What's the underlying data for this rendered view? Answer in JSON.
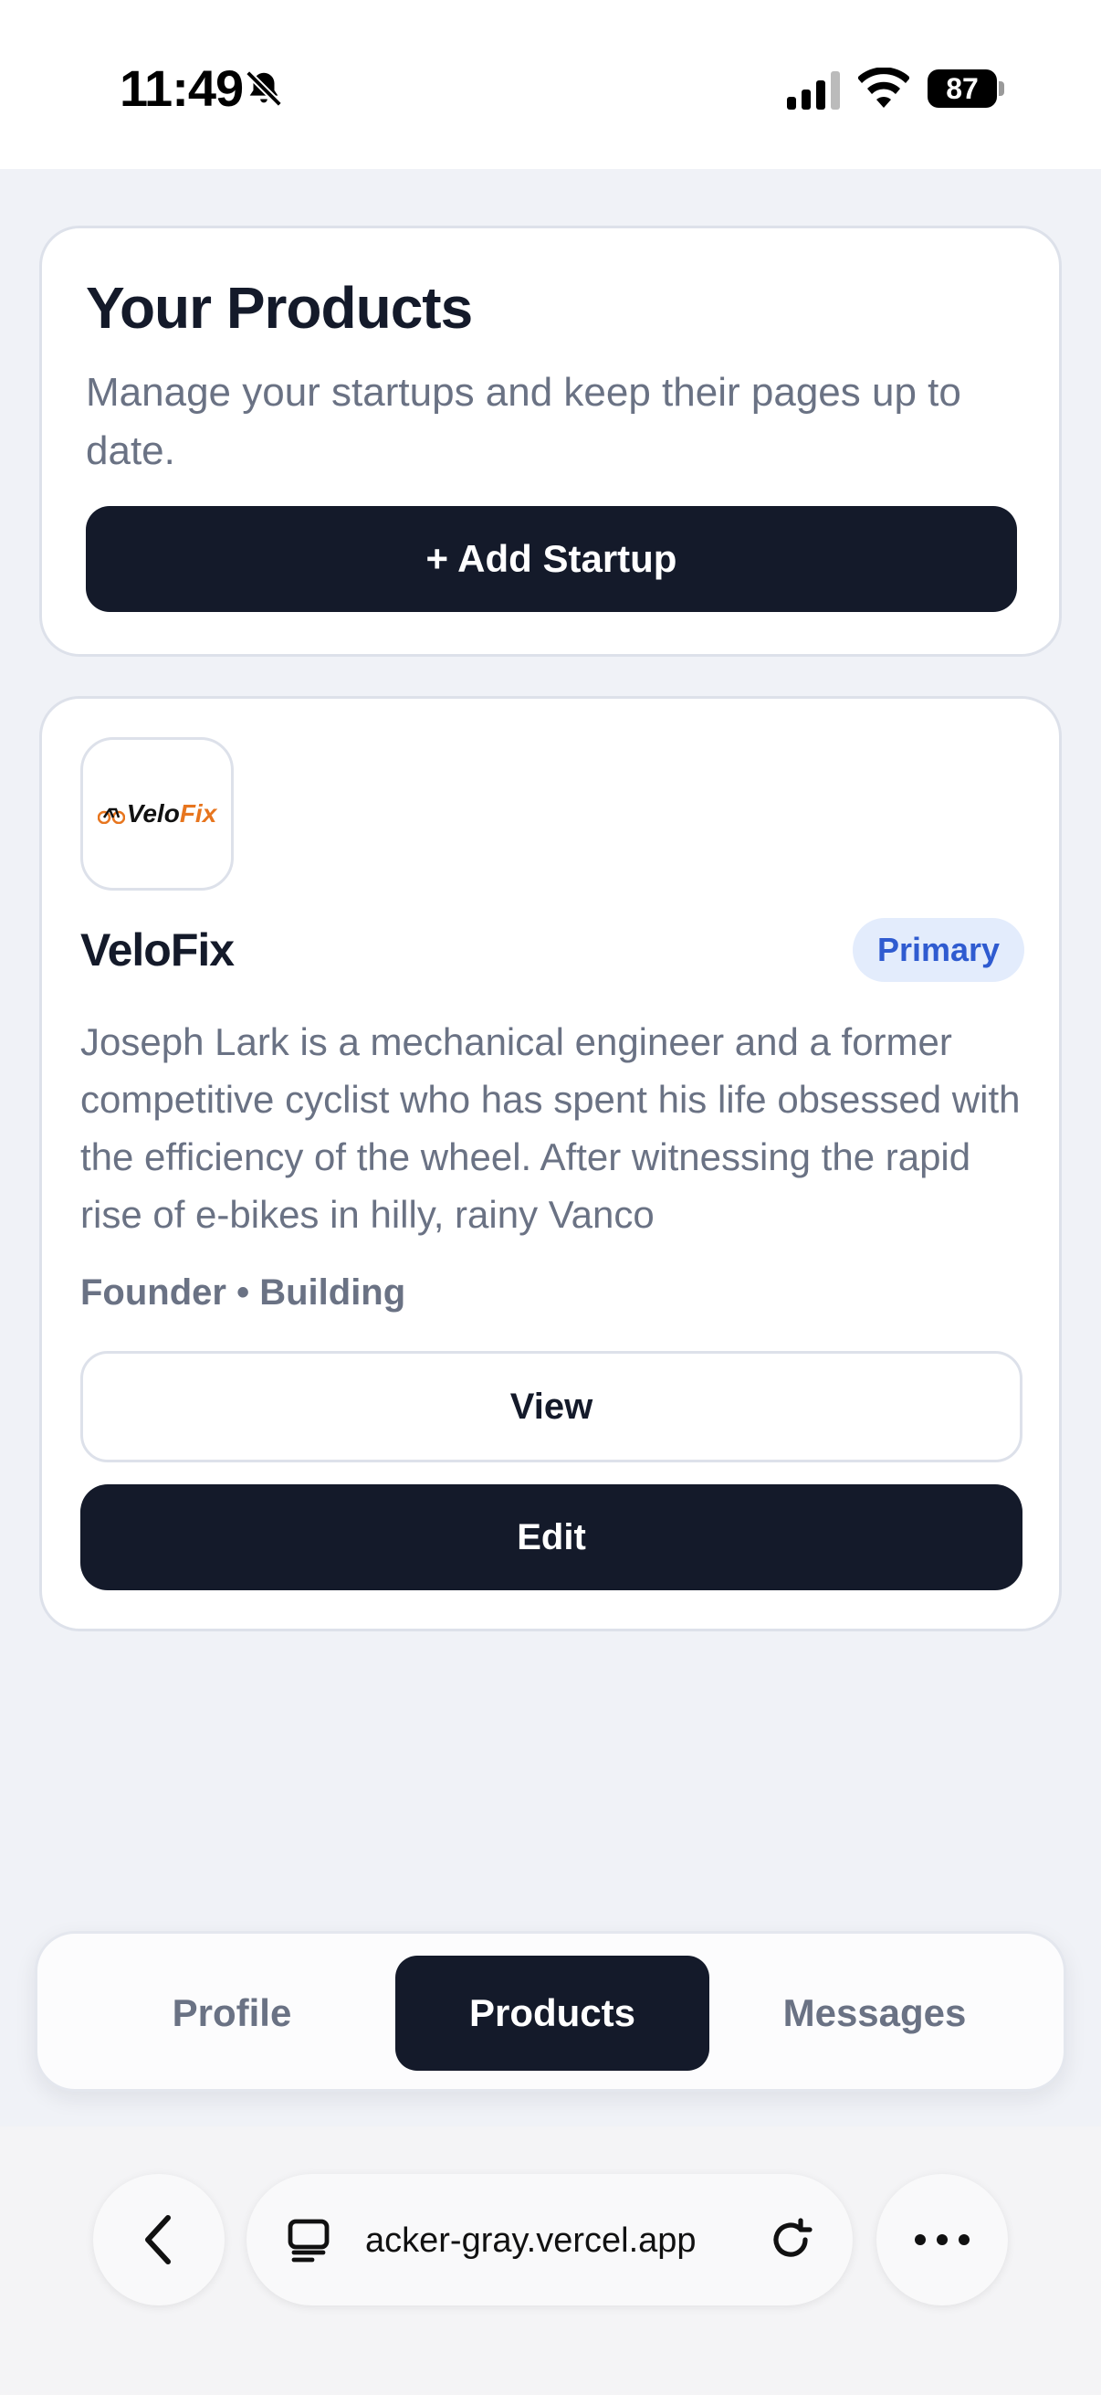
{
  "status_bar": {
    "time": "11:49",
    "battery": "87",
    "icons": [
      "bell-slash-icon",
      "signal-icon",
      "wifi-icon",
      "battery-icon"
    ]
  },
  "hero": {
    "title": "Your Products",
    "subtitle": "Manage your startups and keep their pages up to date.",
    "add_button": "+ Add Startup"
  },
  "product": {
    "logo_text_a": "Velo",
    "logo_text_b": "Fix",
    "name": "VeloFix",
    "badge": "Primary",
    "description": "Joseph Lark is a mechanical engineer and a former competitive cyclist who has spent his life obsessed with the efficiency of the wheel. After witnessing the rapid rise of e-bikes in hilly, rainy Vanco",
    "meta": "Founder • Building",
    "view_button": "View",
    "edit_button": "Edit"
  },
  "tabs": [
    {
      "label": "Profile",
      "active": false
    },
    {
      "label": "Products",
      "active": true
    },
    {
      "label": "Messages",
      "active": false
    }
  ],
  "browser": {
    "url": "acker-gray.vercel.app"
  },
  "colors": {
    "primary_dark": "#141A2A",
    "background": "#F0F2F7",
    "badge_bg": "#E3ECFC",
    "badge_text": "#2F5BD0",
    "logo_accent": "#E7751E",
    "muted_text": "#6A7284"
  }
}
